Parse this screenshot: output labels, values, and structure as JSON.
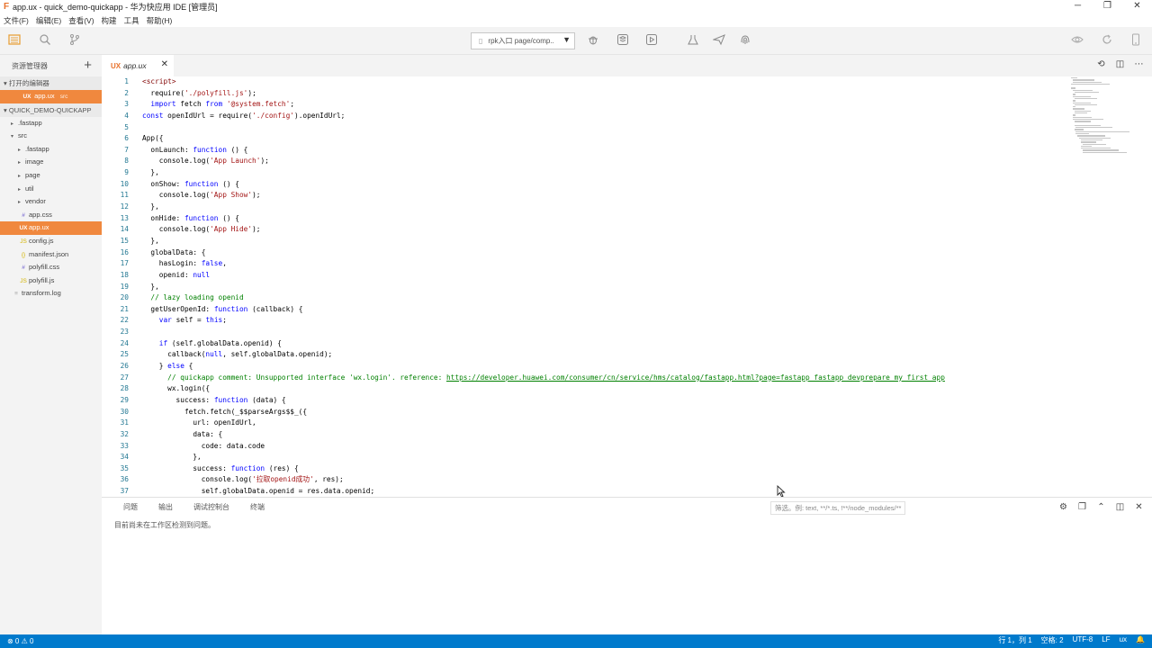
{
  "window": {
    "logo": "F",
    "title": "app.ux - quick_demo-quickapp - 华为快应用 IDE [管理员]",
    "minimize": "─",
    "maximize": "❐",
    "close": "✕"
  },
  "menu": [
    "文件(F)",
    "编辑(E)",
    "查看(V)",
    "构建",
    "工具",
    "帮助(H)"
  ],
  "toolbar": {
    "entry_select": "rpk入口 page/comp..",
    "icons": [
      "explorer-icon",
      "search-icon",
      "source-control-icon",
      "debug-icon",
      "build-icon",
      "run-icon",
      "flask-icon",
      "send-icon",
      "fingerprint-icon",
      "eye-icon",
      "refresh-icon",
      "phone-icon"
    ]
  },
  "sidebar": {
    "title": "资源管理器",
    "open_editors_label": "打开的编辑器",
    "open_editors": [
      {
        "icon": "UX",
        "name": "app.ux",
        "suffix": "src"
      }
    ],
    "project_label": "QUICK_DEMO-QUICKAPP",
    "tree": [
      {
        "indent": 1,
        "twist": "▸",
        "icon": "",
        "name": ".fastapp"
      },
      {
        "indent": 1,
        "twist": "▾",
        "icon": "",
        "name": "src"
      },
      {
        "indent": 2,
        "twist": "▸",
        "icon": "",
        "name": ".fastapp"
      },
      {
        "indent": 2,
        "twist": "▸",
        "icon": "",
        "name": "image"
      },
      {
        "indent": 2,
        "twist": "▸",
        "icon": "",
        "name": "page"
      },
      {
        "indent": 2,
        "twist": "▸",
        "icon": "",
        "name": "util"
      },
      {
        "indent": 2,
        "twist": "▸",
        "icon": "",
        "name": "vendor"
      },
      {
        "indent": 2,
        "twist": "",
        "icon": "#",
        "type": "css",
        "name": "app.css"
      },
      {
        "indent": 2,
        "twist": "",
        "icon": "UX",
        "type": "ux",
        "name": "app.ux",
        "selected": true
      },
      {
        "indent": 2,
        "twist": "",
        "icon": "JS",
        "type": "js",
        "name": "config.js"
      },
      {
        "indent": 2,
        "twist": "",
        "icon": "{}",
        "type": "json",
        "name": "manifest.json"
      },
      {
        "indent": 2,
        "twist": "",
        "icon": "#",
        "type": "css",
        "name": "polyfill.css"
      },
      {
        "indent": 2,
        "twist": "",
        "icon": "JS",
        "type": "js",
        "name": "polyfill.js"
      },
      {
        "indent": 1,
        "twist": "",
        "icon": "≡",
        "type": "log",
        "name": "transform.log"
      }
    ]
  },
  "tab": {
    "icon": "UX",
    "label": "app.ux",
    "close": "✕"
  },
  "editor_actions": [
    "⟲",
    "◫",
    "⋯"
  ],
  "code": {
    "lines": [
      "<script>",
      "  require('./polyfill.js');",
      "  import fetch from '@system.fetch';",
      "const openIdUrl = require('./config').openIdUrl;",
      "",
      "App({",
      "  onLaunch: function () {",
      "    console.log('App Launch');",
      "  },",
      "  onShow: function () {",
      "    console.log('App Show');",
      "  },",
      "  onHide: function () {",
      "    console.log('App Hide');",
      "  },",
      "  globalData: {",
      "    hasLogin: false,",
      "    openid: null",
      "  },",
      "  // lazy loading openid",
      "  getUserOpenId: function (callback) {",
      "    var self = this;",
      "",
      "    if (self.globalData.openid) {",
      "      callback(null, self.globalData.openid);",
      "    } else {",
      "      // quickapp comment: Unsupported interface 'wx.login'. reference: https://developer.huawei.com/consumer/cn/service/hms/catalog/fastapp.html?page=fastapp_fastapp_devprepare_my_first_app",
      "      wx.login({",
      "        success: function (data) {",
      "          fetch.fetch(_$$parseArgs$$_({",
      "            url: openIdUrl,",
      "            data: {",
      "              code: data.code",
      "            },",
      "            success: function (res) {",
      "              console.log('拉取openid成功', res);",
      "              self.globalData.openid = res.data.openid;"
    ]
  },
  "panel": {
    "tabs": [
      "问题",
      "输出",
      "调试控制台",
      "终端"
    ],
    "filter_placeholder": "筛选。例: text, **/*.ts, !**/node_modules/**",
    "message": "目前尚未在工作区检测到问题。",
    "actions": [
      "⚙",
      "❐",
      "⌃",
      "◫",
      "✕"
    ]
  },
  "status": {
    "problems": "⊗ 0 ⚠ 0",
    "position": "行 1，列 1",
    "spaces": "空格: 2",
    "encoding": "UTF-8",
    "eol": "LF",
    "language": "ux",
    "bell": "🔔"
  },
  "colors": {
    "accent": "#f0883e",
    "statusbar": "#007acc",
    "keyword": "#0000ff",
    "string": "#a31515",
    "comment": "#008000",
    "line_number": "#237893"
  }
}
